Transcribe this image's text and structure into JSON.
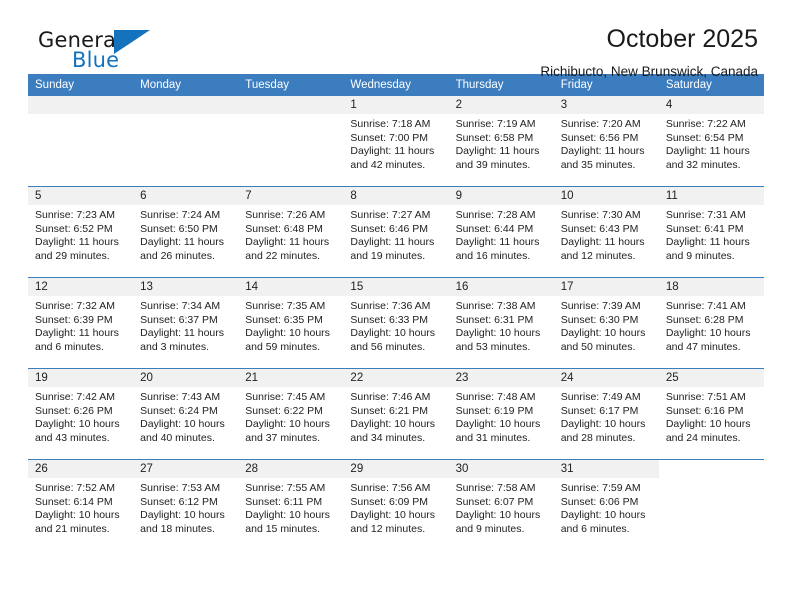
{
  "logo": {
    "word_one": "General",
    "word_two": "Blue",
    "triangle_icon": "blue-triangle-icon",
    "accent_color": "#1573bd"
  },
  "header": {
    "title": "October 2025",
    "subtitle": "Richibucto, New Brunswick, Canada",
    "header_bg_color": "#3b7dbf",
    "daynum_band_color": "#f1f1f1"
  },
  "calendar": {
    "weekday_headers": [
      "Sunday",
      "Monday",
      "Tuesday",
      "Wednesday",
      "Thursday",
      "Friday",
      "Saturday"
    ],
    "weeks": [
      [
        {
          "day": "",
          "lines": []
        },
        {
          "day": "",
          "lines": []
        },
        {
          "day": "",
          "lines": []
        },
        {
          "day": "1",
          "lines": [
            "Sunrise: 7:18 AM",
            "Sunset: 7:00 PM",
            "Daylight: 11 hours and 42 minutes."
          ]
        },
        {
          "day": "2",
          "lines": [
            "Sunrise: 7:19 AM",
            "Sunset: 6:58 PM",
            "Daylight: 11 hours and 39 minutes."
          ]
        },
        {
          "day": "3",
          "lines": [
            "Sunrise: 7:20 AM",
            "Sunset: 6:56 PM",
            "Daylight: 11 hours and 35 minutes."
          ]
        },
        {
          "day": "4",
          "lines": [
            "Sunrise: 7:22 AM",
            "Sunset: 6:54 PM",
            "Daylight: 11 hours and 32 minutes."
          ]
        }
      ],
      [
        {
          "day": "5",
          "lines": [
            "Sunrise: 7:23 AM",
            "Sunset: 6:52 PM",
            "Daylight: 11 hours and 29 minutes."
          ]
        },
        {
          "day": "6",
          "lines": [
            "Sunrise: 7:24 AM",
            "Sunset: 6:50 PM",
            "Daylight: 11 hours and 26 minutes."
          ]
        },
        {
          "day": "7",
          "lines": [
            "Sunrise: 7:26 AM",
            "Sunset: 6:48 PM",
            "Daylight: 11 hours and 22 minutes."
          ]
        },
        {
          "day": "8",
          "lines": [
            "Sunrise: 7:27 AM",
            "Sunset: 6:46 PM",
            "Daylight: 11 hours and 19 minutes."
          ]
        },
        {
          "day": "9",
          "lines": [
            "Sunrise: 7:28 AM",
            "Sunset: 6:44 PM",
            "Daylight: 11 hours and 16 minutes."
          ]
        },
        {
          "day": "10",
          "lines": [
            "Sunrise: 7:30 AM",
            "Sunset: 6:43 PM",
            "Daylight: 11 hours and 12 minutes."
          ]
        },
        {
          "day": "11",
          "lines": [
            "Sunrise: 7:31 AM",
            "Sunset: 6:41 PM",
            "Daylight: 11 hours and 9 minutes."
          ]
        }
      ],
      [
        {
          "day": "12",
          "lines": [
            "Sunrise: 7:32 AM",
            "Sunset: 6:39 PM",
            "Daylight: 11 hours and 6 minutes."
          ]
        },
        {
          "day": "13",
          "lines": [
            "Sunrise: 7:34 AM",
            "Sunset: 6:37 PM",
            "Daylight: 11 hours and 3 minutes."
          ]
        },
        {
          "day": "14",
          "lines": [
            "Sunrise: 7:35 AM",
            "Sunset: 6:35 PM",
            "Daylight: 10 hours and 59 minutes."
          ]
        },
        {
          "day": "15",
          "lines": [
            "Sunrise: 7:36 AM",
            "Sunset: 6:33 PM",
            "Daylight: 10 hours and 56 minutes."
          ]
        },
        {
          "day": "16",
          "lines": [
            "Sunrise: 7:38 AM",
            "Sunset: 6:31 PM",
            "Daylight: 10 hours and 53 minutes."
          ]
        },
        {
          "day": "17",
          "lines": [
            "Sunrise: 7:39 AM",
            "Sunset: 6:30 PM",
            "Daylight: 10 hours and 50 minutes."
          ]
        },
        {
          "day": "18",
          "lines": [
            "Sunrise: 7:41 AM",
            "Sunset: 6:28 PM",
            "Daylight: 10 hours and 47 minutes."
          ]
        }
      ],
      [
        {
          "day": "19",
          "lines": [
            "Sunrise: 7:42 AM",
            "Sunset: 6:26 PM",
            "Daylight: 10 hours and 43 minutes."
          ]
        },
        {
          "day": "20",
          "lines": [
            "Sunrise: 7:43 AM",
            "Sunset: 6:24 PM",
            "Daylight: 10 hours and 40 minutes."
          ]
        },
        {
          "day": "21",
          "lines": [
            "Sunrise: 7:45 AM",
            "Sunset: 6:22 PM",
            "Daylight: 10 hours and 37 minutes."
          ]
        },
        {
          "day": "22",
          "lines": [
            "Sunrise: 7:46 AM",
            "Sunset: 6:21 PM",
            "Daylight: 10 hours and 34 minutes."
          ]
        },
        {
          "day": "23",
          "lines": [
            "Sunrise: 7:48 AM",
            "Sunset: 6:19 PM",
            "Daylight: 10 hours and 31 minutes."
          ]
        },
        {
          "day": "24",
          "lines": [
            "Sunrise: 7:49 AM",
            "Sunset: 6:17 PM",
            "Daylight: 10 hours and 28 minutes."
          ]
        },
        {
          "day": "25",
          "lines": [
            "Sunrise: 7:51 AM",
            "Sunset: 6:16 PM",
            "Daylight: 10 hours and 24 minutes."
          ]
        }
      ],
      [
        {
          "day": "26",
          "lines": [
            "Sunrise: 7:52 AM",
            "Sunset: 6:14 PM",
            "Daylight: 10 hours and 21 minutes."
          ]
        },
        {
          "day": "27",
          "lines": [
            "Sunrise: 7:53 AM",
            "Sunset: 6:12 PM",
            "Daylight: 10 hours and 18 minutes."
          ]
        },
        {
          "day": "28",
          "lines": [
            "Sunrise: 7:55 AM",
            "Sunset: 6:11 PM",
            "Daylight: 10 hours and 15 minutes."
          ]
        },
        {
          "day": "29",
          "lines": [
            "Sunrise: 7:56 AM",
            "Sunset: 6:09 PM",
            "Daylight: 10 hours and 12 minutes."
          ]
        },
        {
          "day": "30",
          "lines": [
            "Sunrise: 7:58 AM",
            "Sunset: 6:07 PM",
            "Daylight: 10 hours and 9 minutes."
          ]
        },
        {
          "day": "31",
          "lines": [
            "Sunrise: 7:59 AM",
            "Sunset: 6:06 PM",
            "Daylight: 10 hours and 6 minutes."
          ]
        },
        {
          "day": "",
          "lines": [],
          "empty": true
        }
      ]
    ]
  }
}
